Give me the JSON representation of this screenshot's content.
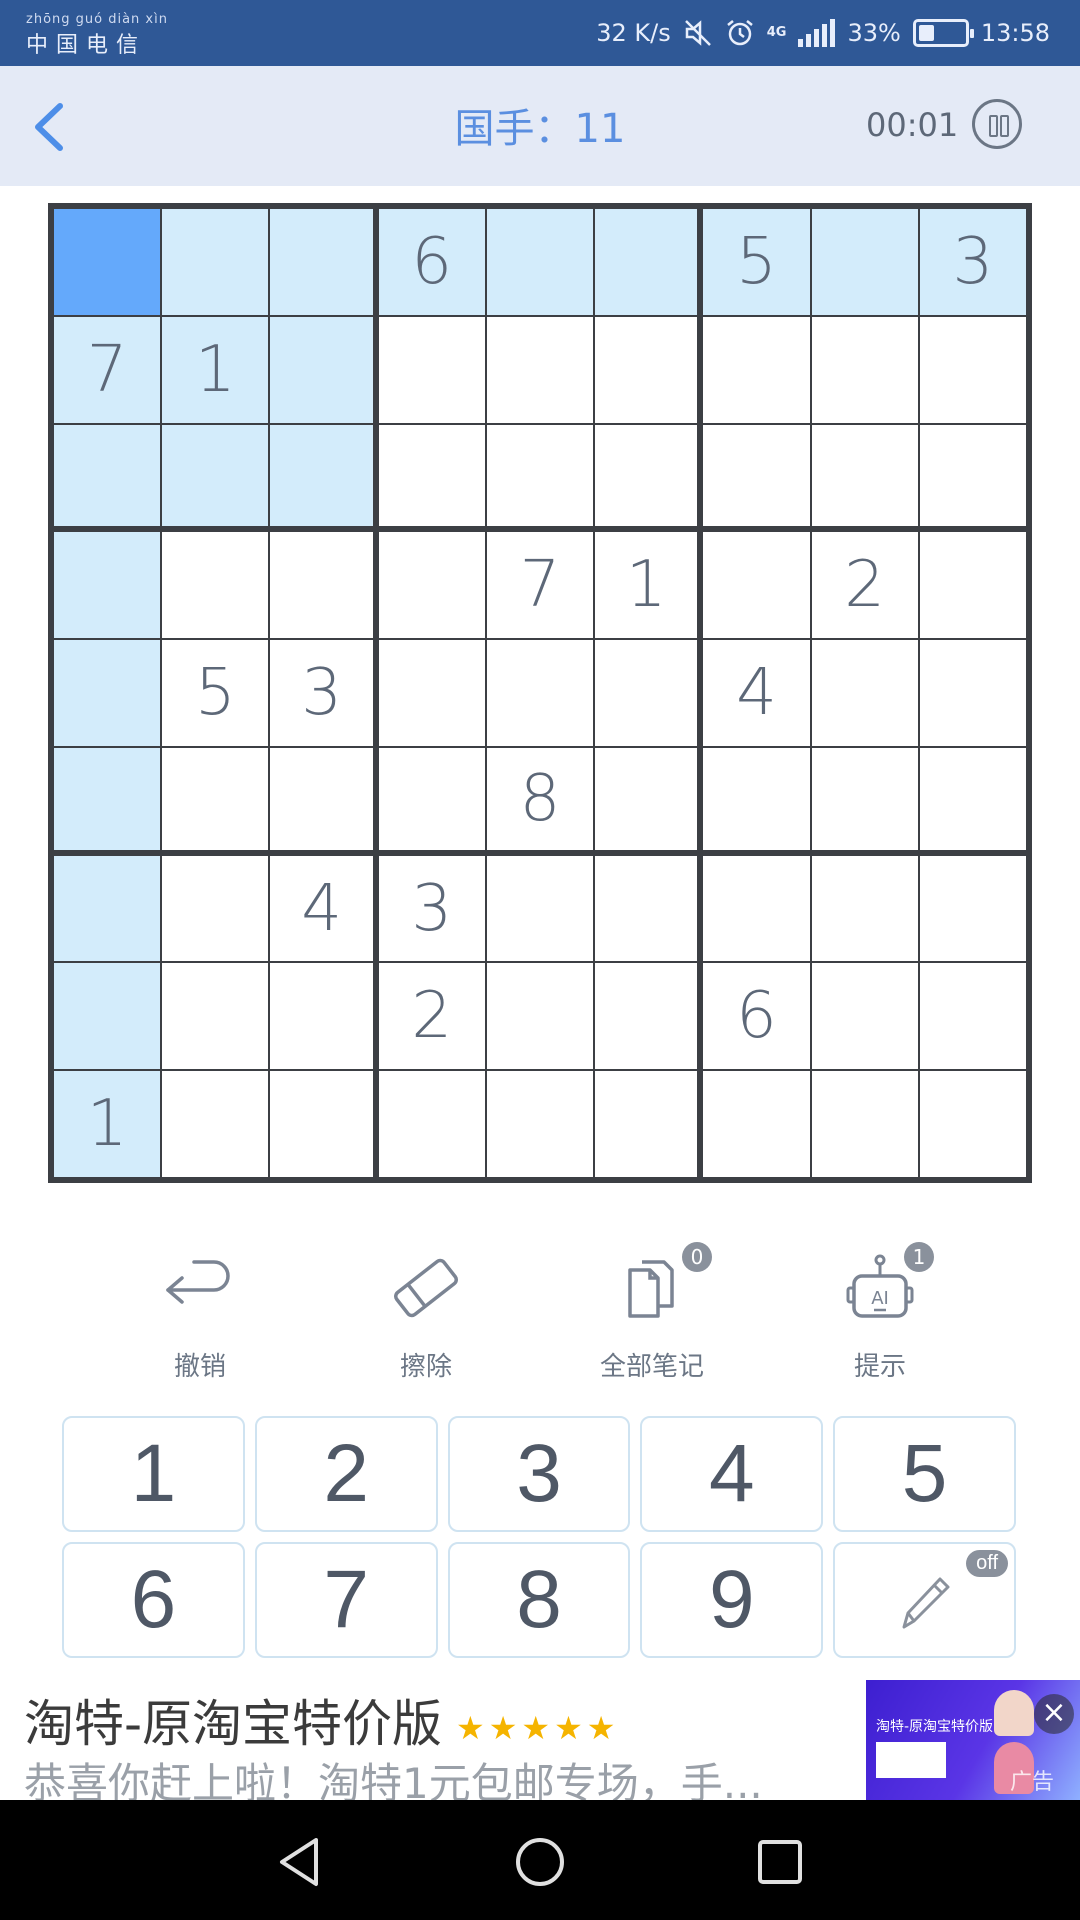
{
  "status_bar": {
    "carrier_pinyin": "zhōng guó diàn xìn",
    "carrier": "中国电信",
    "speed": "32 K/s",
    "network": "4G",
    "battery": "33%",
    "battery_level": 0.33,
    "time": "13:58",
    "icons": [
      "mute-icon",
      "alarm-icon",
      "4g-icon",
      "signal-icon",
      "battery-icon"
    ]
  },
  "header": {
    "back_icon": "chevron-left-icon",
    "title": "国手：11",
    "timer": "00:01",
    "pause_icon": "pause-icon"
  },
  "board": {
    "grid": [
      [
        "",
        "",
        "",
        "6",
        "",
        "",
        "5",
        "",
        "3"
      ],
      [
        "7",
        "1",
        "",
        "",
        "",
        "",
        "",
        "",
        ""
      ],
      [
        "",
        "",
        "",
        "",
        "",
        "",
        "",
        "",
        ""
      ],
      [
        "",
        "",
        "",
        "",
        "7",
        "1",
        "",
        "2",
        ""
      ],
      [
        "",
        "5",
        "3",
        "",
        "",
        "",
        "4",
        "",
        ""
      ],
      [
        "",
        "",
        "",
        "",
        "8",
        "",
        "",
        "",
        ""
      ],
      [
        "",
        "",
        "4",
        "3",
        "",
        "",
        "",
        "",
        ""
      ],
      [
        "",
        "",
        "",
        "2",
        "",
        "",
        "6",
        "",
        ""
      ],
      [
        "1",
        "",
        "",
        "",
        "",
        "",
        "",
        "",
        ""
      ]
    ],
    "selected_cell": [
      0,
      0
    ],
    "colors": {
      "selected": "#64a9fb",
      "highlight": "#d3ecfb",
      "number": "#5d6878"
    }
  },
  "tools": [
    {
      "label": "撤销",
      "icon": "undo-icon"
    },
    {
      "label": "擦除",
      "icon": "eraser-icon"
    },
    {
      "label": "全部笔记",
      "icon": "notes-icon",
      "badge": "0"
    },
    {
      "label": "提示",
      "icon": "ai-hint-icon",
      "badge": "1"
    }
  ],
  "keypad": {
    "keys": [
      "1",
      "2",
      "3",
      "4",
      "5",
      "6",
      "7",
      "8",
      "9"
    ],
    "pencil_badge": "off",
    "pencil_icon": "pencil-icon"
  },
  "ad": {
    "title": "淘特-原淘宝特价版",
    "stars": "★★★★★",
    "description": "恭喜你赶上啦！淘特1元包邮专场，手...",
    "image_text": "淘特-原淘宝特价版",
    "tag": "广告",
    "close_icon": "close-icon"
  },
  "navbar": {
    "icons": [
      "back-triangle-icon",
      "home-circle-icon",
      "recents-square-icon"
    ]
  }
}
